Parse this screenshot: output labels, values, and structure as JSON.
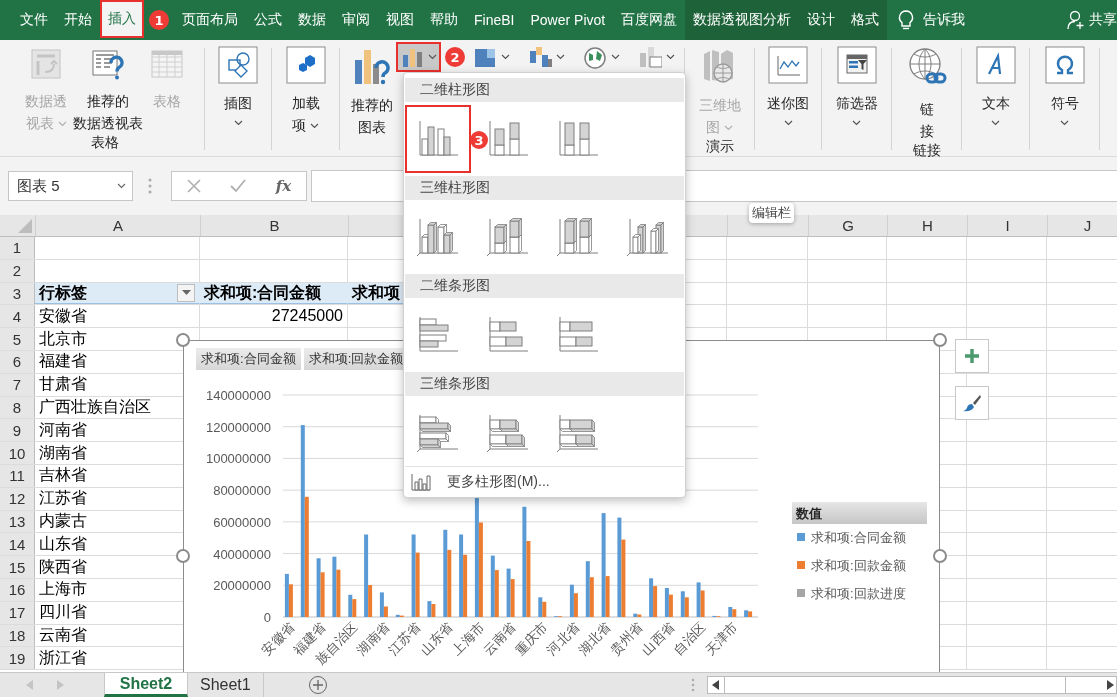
{
  "ribbon_tabs": [
    {
      "label": "文件",
      "selected": false
    },
    {
      "label": "开始",
      "selected": false
    },
    {
      "label": "插入",
      "selected": true,
      "badge": "1"
    },
    {
      "label": "页面布局",
      "selected": false
    },
    {
      "label": "公式",
      "selected": false
    },
    {
      "label": "数据",
      "selected": false
    },
    {
      "label": "审阅",
      "selected": false
    },
    {
      "label": "视图",
      "selected": false
    },
    {
      "label": "帮助",
      "selected": false
    },
    {
      "label": "FineBI",
      "selected": false
    },
    {
      "label": "Power Pivot",
      "selected": false
    },
    {
      "label": "百度网盘",
      "selected": false
    },
    {
      "label": "数据透视图分析",
      "selected": false,
      "contextual": true
    },
    {
      "label": "设计",
      "selected": false,
      "contextual": true
    },
    {
      "label": "格式",
      "selected": false,
      "contextual": true
    }
  ],
  "tell_me": "告诉我",
  "share": "共享",
  "ribbon_groups": [
    {
      "label": "表格",
      "buttons": [
        {
          "kind": "pivot",
          "lines": [
            "数据透",
            "视表"
          ],
          "disabled": true,
          "dropdown": true
        },
        {
          "kind": "recpivot",
          "lines": [
            "推荐的",
            "数据透视表"
          ],
          "disabled": false
        },
        {
          "kind": "table",
          "lines": [
            "表格"
          ],
          "disabled": true
        }
      ]
    },
    {
      "buttons": [
        {
          "kind": "illustrations",
          "lines": [
            "插图"
          ],
          "disabled": false,
          "dropdown": true
        }
      ]
    },
    {
      "buttons": [
        {
          "kind": "addins",
          "lines": [
            "加载",
            "项"
          ],
          "disabled": false,
          "dropdown": true
        }
      ]
    },
    {
      "buttons": [
        {
          "kind": "recchart",
          "lines": [
            "推荐的",
            "图表"
          ],
          "disabled": false
        }
      ],
      "small_buttons": [
        {
          "kind": "column",
          "selected": true,
          "badge": "2"
        },
        {
          "kind": "hierarchy",
          "selected": false
        },
        {
          "kind": "waterfall",
          "selected": false
        },
        {
          "kind": "map",
          "selected": false
        },
        {
          "kind": "pivotchart",
          "selected": false
        }
      ]
    },
    {
      "label": "演示",
      "buttons": [
        {
          "kind": "map3d",
          "lines": [
            "三维地",
            "图"
          ],
          "disabled": true,
          "dropdown": true
        }
      ]
    },
    {
      "buttons": [
        {
          "kind": "sparkline",
          "lines": [
            "迷你图"
          ],
          "disabled": false,
          "dropdown": true
        }
      ]
    },
    {
      "buttons": [
        {
          "kind": "slicer",
          "lines": [
            "筛选器"
          ],
          "disabled": false,
          "dropdown": true
        }
      ]
    },
    {
      "label": "链接",
      "buttons": [
        {
          "kind": "link",
          "lines": [
            "链",
            "接"
          ],
          "disabled": false
        }
      ]
    },
    {
      "buttons": [
        {
          "kind": "text",
          "lines": [
            "文本"
          ],
          "disabled": false,
          "dropdown": true
        }
      ]
    },
    {
      "buttons": [
        {
          "kind": "symbol",
          "lines": [
            "符号"
          ],
          "disabled": false,
          "dropdown": true
        }
      ]
    }
  ],
  "name_box": {
    "value": "图表 5"
  },
  "function_button": "fx",
  "tooltip": "编辑栏",
  "sheet": {
    "columns": [
      "A",
      "B",
      null,
      null,
      null,
      null,
      "G",
      "H",
      "I",
      "J"
    ],
    "rows": [
      {
        "number": "1"
      },
      {
        "number": "2"
      },
      {
        "number": "3",
        "kind": "header",
        "cells": [
          "行标签",
          "求和项:合同金额",
          "求和项"
        ]
      },
      {
        "number": "4",
        "cells": [
          "安徽省",
          "27245000"
        ]
      },
      {
        "number": "5",
        "cells": [
          "北京市"
        ]
      },
      {
        "number": "6",
        "cells": [
          "福建省"
        ]
      },
      {
        "number": "7",
        "cells": [
          "甘肃省"
        ]
      },
      {
        "number": "8",
        "cells": [
          "广西壮族自治区"
        ]
      },
      {
        "number": "9",
        "cells": [
          "河南省"
        ]
      },
      {
        "number": "10",
        "cells": [
          "湖南省"
        ]
      },
      {
        "number": "11",
        "cells": [
          "吉林省"
        ]
      },
      {
        "number": "12",
        "cells": [
          "江苏省"
        ]
      },
      {
        "number": "13",
        "cells": [
          "内蒙古"
        ]
      },
      {
        "number": "14",
        "cells": [
          "山东省"
        ]
      },
      {
        "number": "15",
        "cells": [
          "陕西省"
        ]
      },
      {
        "number": "16",
        "cells": [
          "上海市"
        ]
      },
      {
        "number": "17",
        "cells": [
          "四川省"
        ]
      },
      {
        "number": "18",
        "cells": [
          "云南省"
        ]
      },
      {
        "number": "19",
        "cells": [
          "浙江省"
        ]
      }
    ]
  },
  "chart": {
    "field_buttons": [
      "求和项:合同金额",
      "求和项:回款金额"
    ],
    "legend_title": "数值",
    "chart_data": {
      "type": "bar",
      "grid": true,
      "legend": true,
      "ylim": [
        0,
        140000000
      ],
      "yticks": [
        0,
        20000000,
        40000000,
        60000000,
        80000000,
        100000000,
        120000000,
        140000000
      ],
      "categories": [
        "安徽省",
        null,
        "福建省",
        null,
        "族自治区",
        null,
        "湖南省",
        null,
        "江苏省",
        null,
        "山东省",
        null,
        "上海市",
        null,
        "云南省",
        null,
        "重庆市",
        null,
        "河北省",
        null,
        "湖北省",
        null,
        "贵州省",
        null,
        "山西省",
        null,
        "自治区",
        null,
        "天津市",
        null
      ],
      "series": [
        {
          "name": "求和项:合同金额",
          "color": "#5b9bd5",
          "values": [
            27200000,
            121000000,
            37000000,
            38000000,
            14000000,
            52000000,
            15500000,
            1400000,
            52000000,
            10000000,
            55000000,
            52000000,
            75000000,
            38700000,
            30500000,
            69500000,
            12400000,
            0,
            20400000,
            35200000,
            65500000,
            62700000,
            2100000,
            24400000,
            18300000,
            16200000,
            21800000,
            700000,
            6300000,
            4200000
          ]
        },
        {
          "name": "求和项:回款金额",
          "color": "#ed7d31",
          "values": [
            20600000,
            75800000,
            28200000,
            29800000,
            11300000,
            20200000,
            6600000,
            900000,
            40600000,
            8200000,
            42300000,
            39200000,
            59600000,
            29600000,
            23900000,
            47900000,
            9600000,
            0,
            15000000,
            25100000,
            25800000,
            48800000,
            1600000,
            19500000,
            14100000,
            12400000,
            16700000,
            500000,
            4900000,
            3500000
          ]
        },
        {
          "name": "求和项:回款进度",
          "color": "#a5a5a5",
          "values": [
            null,
            null,
            null,
            null,
            null,
            null,
            null,
            null,
            null,
            null,
            null,
            null,
            null,
            null,
            null,
            null,
            null,
            null,
            null,
            null,
            null,
            null,
            null,
            null,
            null,
            null,
            null,
            null,
            null,
            null
          ]
        }
      ]
    }
  },
  "chart_menu": {
    "sections": [
      {
        "title": "二维柱形图",
        "kind": "column",
        "items": [
          {
            "kind": "clustered",
            "selected": true,
            "badge": "3"
          },
          {
            "kind": "stacked",
            "selected": false
          },
          {
            "kind": "percent",
            "selected": false
          }
        ]
      },
      {
        "title": "三维柱形图",
        "kind": "column3d",
        "items": [
          {
            "kind": "clustered",
            "selected": false
          },
          {
            "kind": "stacked",
            "selected": false
          },
          {
            "kind": "percent",
            "selected": false
          },
          {
            "kind": "deep",
            "selected": false
          }
        ]
      },
      {
        "title": "二维条形图",
        "kind": "bar",
        "items": [
          {
            "kind": "clustered",
            "selected": false
          },
          {
            "kind": "stacked",
            "selected": false
          },
          {
            "kind": "percent",
            "selected": false
          }
        ]
      },
      {
        "title": "三维条形图",
        "kind": "bar3d",
        "items": [
          {
            "kind": "clustered",
            "selected": false
          },
          {
            "kind": "stacked",
            "selected": false
          },
          {
            "kind": "percent",
            "selected": false
          }
        ]
      }
    ],
    "more": "更多柱形图(M)..."
  },
  "sheet_tabs": [
    {
      "label": "Sheet2",
      "selected": true
    },
    {
      "label": "Sheet1",
      "selected": false
    }
  ]
}
